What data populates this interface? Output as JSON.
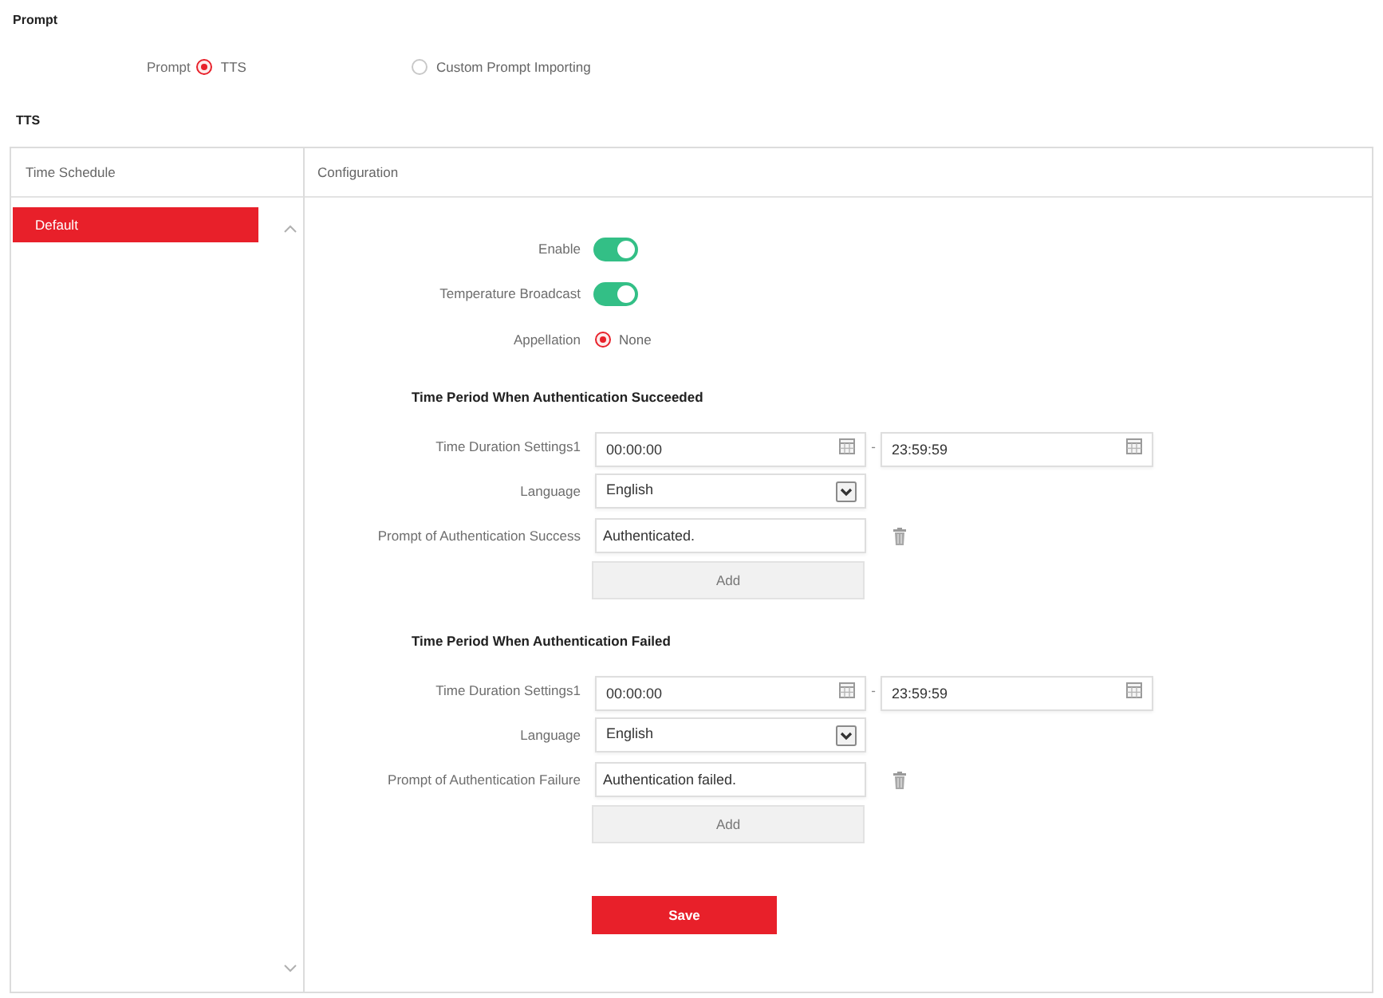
{
  "prompt_section": {
    "title": "Prompt",
    "label": "Prompt",
    "options": [
      {
        "label": "TTS",
        "selected": true
      },
      {
        "label": "Custom Prompt Importing",
        "selected": false
      }
    ]
  },
  "tts": {
    "title": "TTS",
    "schedule": {
      "header": "Time Schedule",
      "items": [
        {
          "label": "Default",
          "selected": true
        }
      ]
    },
    "configuration": {
      "header": "Configuration",
      "switches": [
        {
          "label": "Enable",
          "on": true
        },
        {
          "label": "Temperature Broadcast",
          "on": true
        }
      ],
      "appellation": {
        "label": "Appellation",
        "options": [
          {
            "label": "None",
            "selected": true
          }
        ]
      },
      "periods": [
        {
          "title": "Time Period When Authentication Succeeded",
          "duration_label": "Time Duration Settings1",
          "start": "00:00:00",
          "range_separator": "-",
          "end": "23:59:59",
          "language_label": "Language",
          "language": "English",
          "prompt_label": "Prompt of Authentication Success",
          "prompt_value": "Authenticated.",
          "add_button": "Add"
        },
        {
          "title": "Time Period When Authentication Failed",
          "duration_label": "Time Duration Settings1",
          "start": "00:00:00",
          "range_separator": "-",
          "end": "23:59:59",
          "language_label": "Language",
          "language": "English",
          "prompt_label": "Prompt of Authentication Failure",
          "prompt_value": "Authentication failed.",
          "add_button": "Add"
        }
      ],
      "save_button": "Save"
    }
  }
}
